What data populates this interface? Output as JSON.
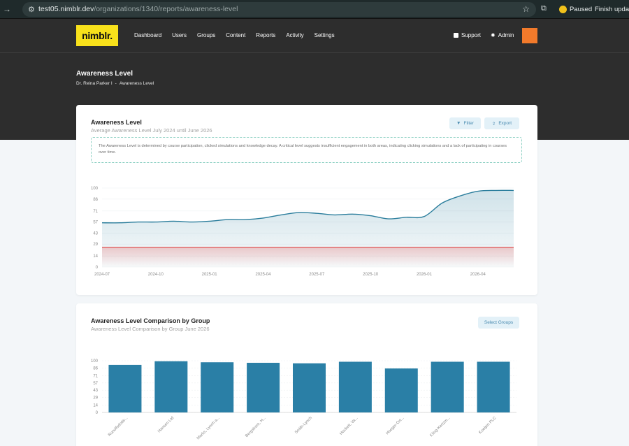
{
  "browser": {
    "url_host": "test05.nimblr.dev",
    "url_path": "/organizations/1340/reports/awareness-level",
    "profile_status": "Paused",
    "finish_update_label": "Finish update"
  },
  "header": {
    "logo_text": "nimblr.",
    "nav": [
      "Dashboard",
      "Users",
      "Groups",
      "Content",
      "Reports",
      "Activity",
      "Settings"
    ],
    "support_label": "Support",
    "admin_label": "Admin",
    "accent_color": "#f27a2b",
    "logo_color": "#f8e11b"
  },
  "page": {
    "title": "Awareness Level",
    "breadcrumb": [
      "Dr. Reina Parker I",
      "-",
      "Awareness Level"
    ]
  },
  "card1": {
    "title": "Awareness Level",
    "subtitle": "Average Awareness Level July 2024 until June 2026",
    "filter_label": "Filter",
    "export_label": "Export",
    "info_text": "The Awareness Level is determined by course participation, clicked simulations and knowledge decay. A critical level suggests insufficient engagement in both areas, indicating clicking simulations and a lack of participating in courses over time."
  },
  "card2": {
    "title": "Awareness Level Comparison by Group",
    "subtitle": "Awareness Level Comparison by Group June 2026",
    "select_groups_label": "Select Groups"
  },
  "chart_data": [
    {
      "type": "area",
      "ylim": [
        0,
        100
      ],
      "yticks": [
        "100",
        "86",
        "71",
        "57",
        "43",
        "29",
        "14",
        "0"
      ],
      "ytick_values": [
        100,
        86,
        71,
        57,
        43,
        29,
        14,
        0
      ],
      "xticks": [
        "2024-07",
        "2024-10",
        "2025-01",
        "2025-04",
        "2025-07",
        "2025-10",
        "2026-01",
        "2026-04"
      ],
      "x_range_months": [
        0,
        23
      ],
      "threshold": 25,
      "series_color": "#2a7d9c",
      "threshold_color": "#e05555",
      "points": [
        [
          0,
          56
        ],
        [
          1,
          56
        ],
        [
          2,
          57
        ],
        [
          3,
          57
        ],
        [
          4,
          58
        ],
        [
          5,
          57
        ],
        [
          6,
          58
        ],
        [
          7,
          60
        ],
        [
          8,
          60
        ],
        [
          9,
          62
        ],
        [
          10,
          66
        ],
        [
          11,
          69
        ],
        [
          12,
          68
        ],
        [
          13,
          66
        ],
        [
          14,
          67
        ],
        [
          15,
          65
        ],
        [
          16,
          61
        ],
        [
          17,
          63
        ],
        [
          18,
          64
        ],
        [
          19,
          81
        ],
        [
          20,
          90
        ],
        [
          21,
          96
        ],
        [
          22,
          97
        ],
        [
          23,
          97
        ]
      ]
    },
    {
      "type": "bar",
      "ylim": [
        0,
        100
      ],
      "yticks": [
        "100",
        "86",
        "71",
        "57",
        "43",
        "29",
        "14",
        "0"
      ],
      "ytick_values": [
        100,
        86,
        71,
        57,
        43,
        29,
        14,
        0
      ],
      "categories": [
        "Runolfsdottir...",
        "Hansen Ltd",
        "Marks, Lynch a...",
        "Bergstrom, H...",
        "Smith-Lynch",
        "Hackett, Va...",
        "Hoeger-Ort...",
        "Kling-Kertzm...",
        "Koelpin PLC"
      ],
      "values": [
        92,
        99,
        97,
        96,
        95,
        98,
        85,
        98,
        98
      ],
      "bar_color": "#2a7fa6"
    }
  ]
}
